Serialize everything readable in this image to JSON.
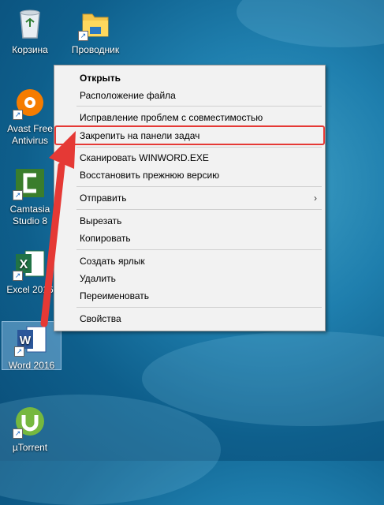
{
  "desktop": {
    "icons": [
      {
        "label": "Корзина",
        "icon": "recycle-bin-icon"
      },
      {
        "label": "Проводник",
        "icon": "folder-icon"
      },
      {
        "label": "Avast Free Antivirus",
        "icon": "avast-icon"
      },
      {
        "label": "Camtasia Studio 8",
        "icon": "camtasia-icon"
      },
      {
        "label": "Excel 2016",
        "icon": "excel-icon"
      },
      {
        "label": "Word 2016",
        "icon": "word-icon"
      },
      {
        "label": "µTorrent",
        "icon": "utorrent-icon"
      }
    ]
  },
  "context_menu": {
    "items": [
      {
        "label": "Открыть",
        "bold": true
      },
      {
        "label": "Расположение файла"
      },
      {
        "label": "Исправление проблем с совместимостью"
      },
      {
        "label": "Закрепить на панели задач",
        "highlighted": true
      },
      {
        "label": "Сканировать WINWORD.EXE"
      },
      {
        "label": "Восстановить прежнюю версию"
      },
      {
        "label": "Отправить",
        "submenu_arrow": "›"
      },
      {
        "label": "Вырезать"
      },
      {
        "label": "Копировать"
      },
      {
        "label": "Создать ярлык"
      },
      {
        "label": "Удалить"
      },
      {
        "label": "Переименовать"
      },
      {
        "label": "Свойства"
      }
    ]
  },
  "colors": {
    "highlight_border": "#e53935",
    "arrow": "#e53935",
    "word_blue": "#2b579a",
    "excel_green": "#217346",
    "avast_orange": "#f57c00",
    "utorrent_green": "#76b83f"
  }
}
